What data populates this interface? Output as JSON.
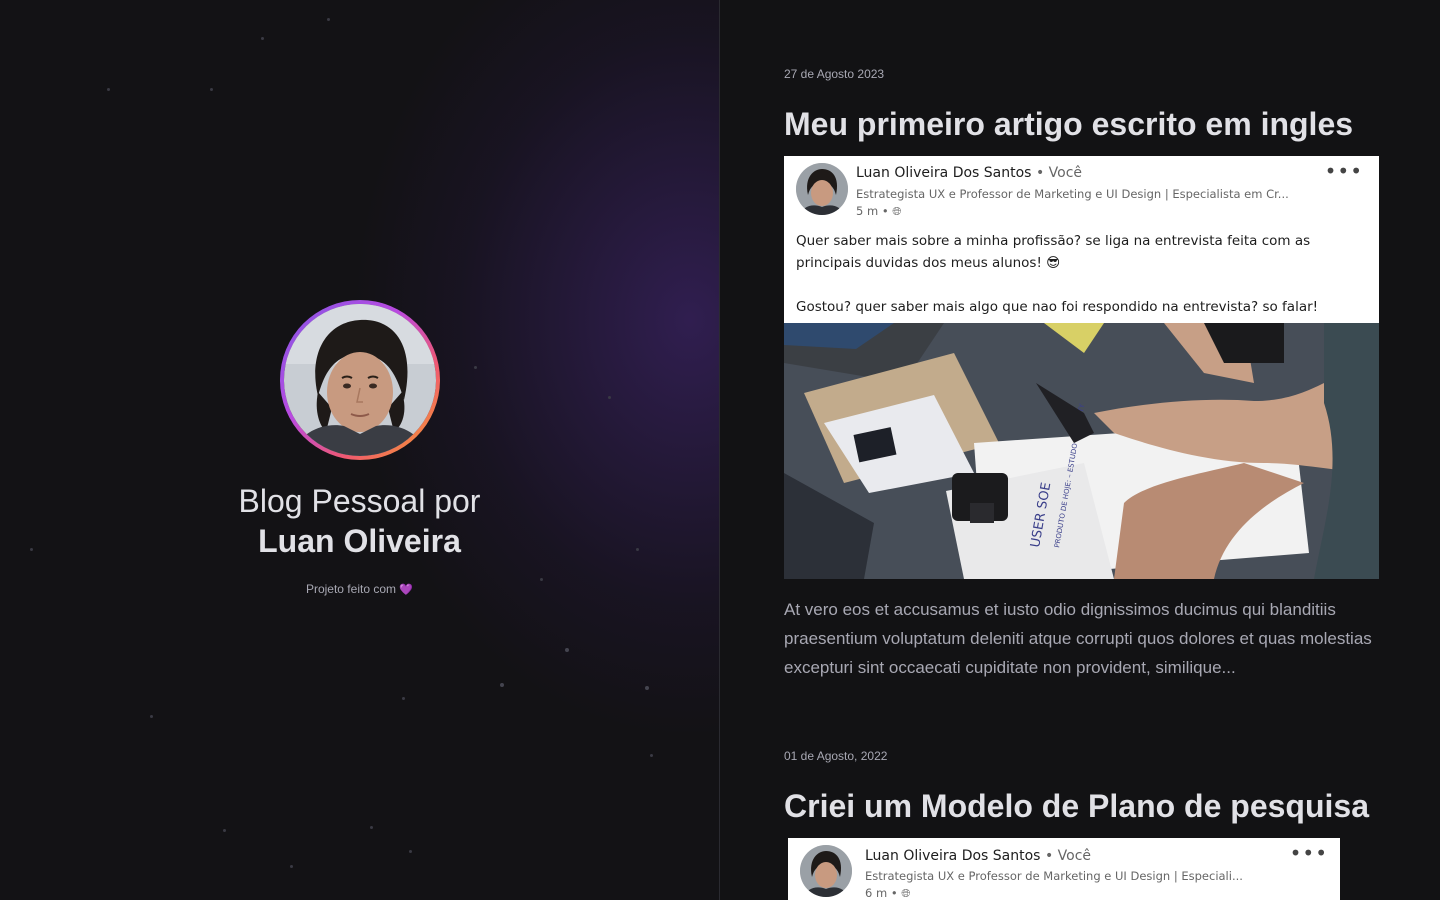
{
  "profile": {
    "blog_title": "Blog Pessoal por",
    "author_name": "Luan Oliveira",
    "footer_note": "Projeto feito com",
    "footer_icon": "heart-icon",
    "ring_colors": [
      "#8257e5",
      "#b94ae0",
      "#f0596f",
      "#f5a623"
    ]
  },
  "posts": [
    {
      "date": "27 de Agosto 2023",
      "title": "Meu primeiro artigo escrito em ingles",
      "card": {
        "author": "Luan Oliveira Dos Santos",
        "badge": "• Você",
        "headline": "Estrategista UX e Professor de Marketing e UI Design | Especialista em Cr...",
        "meta": "5 m •",
        "text_line_1": "Quer saber mais sobre a minha profissão? se liga na entrevista feita com as",
        "text_line_2": "principais duvidas dos meus alunos! 😎",
        "text_line_3": "Gostou? quer saber mais algo que nao foi respondido na entrevista? so falar!",
        "photo_note_1": "USER SOE",
        "photo_note_2": "PRODUTO DE HOJE: – ESTUDO – PRIORITY"
      },
      "excerpt": "At vero eos et accusamus et iusto odio dignissimos ducimus qui blanditiis praesentium voluptatum deleniti atque corrupti quos dolores et quas molestias excepturi sint occaecati cupiditate non provident, similique..."
    },
    {
      "date": "01 de Agosto, 2022",
      "title": "Criei um Modelo de Plano de pesquisa",
      "card": {
        "author": "Luan Oliveira Dos Santos",
        "badge": "• Você",
        "headline": "Estrategista UX e Professor de Marketing e UI Design | Especiali...",
        "meta": "6 m •"
      }
    }
  ],
  "colors": {
    "background": "#121214",
    "text": "#e1e1e6",
    "muted": "#a8a8b3",
    "accent": "#8257e5"
  }
}
